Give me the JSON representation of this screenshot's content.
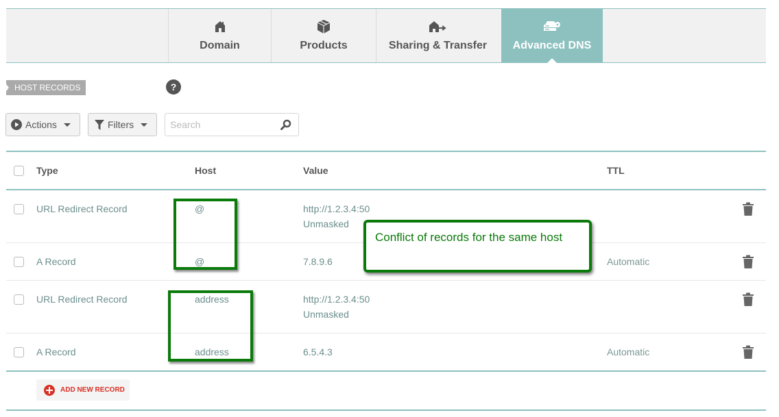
{
  "tabs": [
    {
      "label": "Domain",
      "icon": "home-icon",
      "active": false
    },
    {
      "label": "Products",
      "icon": "box-icon",
      "active": false
    },
    {
      "label": "Sharing & Transfer",
      "icon": "house-transfer-icon",
      "active": false
    },
    {
      "label": "Advanced DNS",
      "icon": "dns-server-icon",
      "active": true
    }
  ],
  "section": {
    "label": "HOST RECORDS",
    "help": "?"
  },
  "toolbar": {
    "actions_label": "Actions",
    "filters_label": "Filters",
    "search_placeholder": "Search",
    "search_value": ""
  },
  "table": {
    "headers": {
      "type": "Type",
      "host": "Host",
      "value": "Value",
      "ttl": "TTL"
    },
    "rows": [
      {
        "type": "URL Redirect Record",
        "host": "@",
        "value": "http://1.2.3.4:50",
        "value_sub": "Unmasked",
        "ttl": ""
      },
      {
        "type": "A Record",
        "host": "@",
        "value": "7.8.9.6",
        "value_sub": "",
        "ttl": "Automatic"
      },
      {
        "type": "URL Redirect Record",
        "host": "address",
        "value": "http://1.2.3.4:50",
        "value_sub": "Unmasked",
        "ttl": ""
      },
      {
        "type": "A Record",
        "host": "address",
        "value": "6.5.4.3",
        "value_sub": "",
        "ttl": "Automatic"
      }
    ]
  },
  "annotation": {
    "text": "Conflict of records for the same host",
    "color": "#0a7a0a"
  },
  "add_record_label": "ADD NEW RECORD",
  "colors": {
    "accent": "#8cc1bf",
    "danger": "#d93025"
  }
}
